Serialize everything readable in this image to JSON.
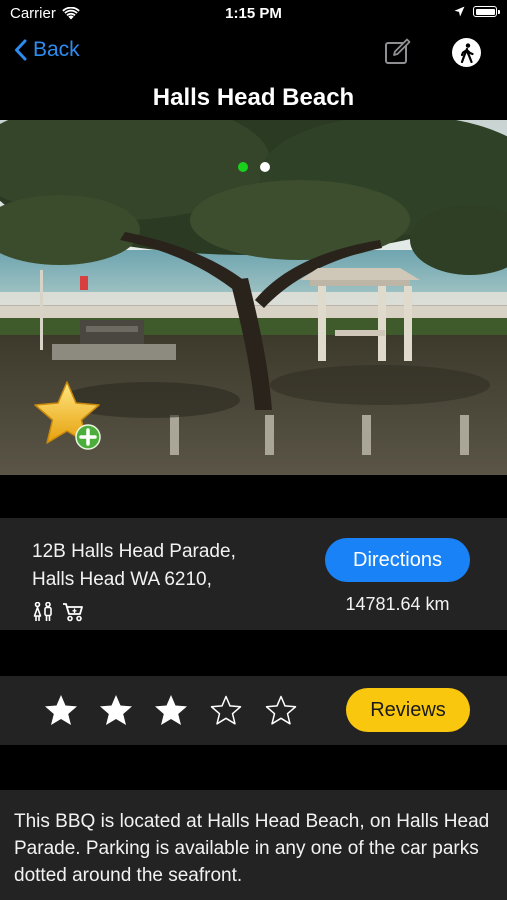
{
  "status_bar": {
    "carrier": "Carrier",
    "time": "1:15 PM"
  },
  "nav": {
    "back_label": "Back",
    "title": "Halls Head Beach",
    "edit_icon": "edit-icon",
    "walk_icon": "pedestrian-icon"
  },
  "gallery": {
    "page_count": 2,
    "current_page": 1,
    "active_dot_color": "#19d11d",
    "inactive_dot_color": "#ffffff"
  },
  "favorite": {
    "icon": "star-add-icon"
  },
  "location": {
    "address_line1": "12B Halls Head Parade,",
    "address_line2": "Halls Head WA 6210,",
    "amenities": [
      "toilets-icon",
      "stroller-icon"
    ],
    "directions_label": "Directions",
    "distance": "14781.64 km",
    "accent_color": "#1a82f7"
  },
  "rating": {
    "value": 3,
    "max": 5,
    "reviews_label": "Reviews",
    "reviews_color": "#f9c80e"
  },
  "description": "This BBQ is located at Halls Head Beach, on Halls Head Parade. Parking is available in any one of the car parks dotted around the seafront."
}
